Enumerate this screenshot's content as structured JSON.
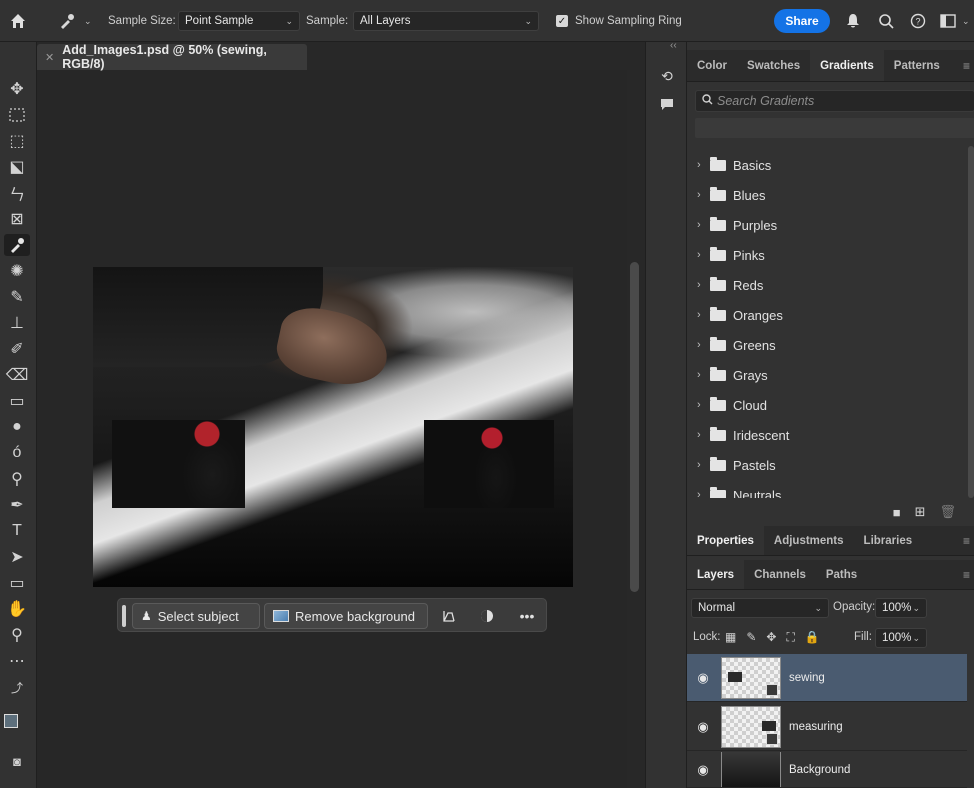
{
  "options_bar": {
    "sample_size_label": "Sample Size:",
    "sample_size_value": "Point Sample",
    "sample_label": "Sample:",
    "sample_value": "All Layers",
    "show_sampling_ring_label": "Show Sampling Ring",
    "show_sampling_ring_checked": true,
    "share_label": "Share"
  },
  "document": {
    "tab_title": "Add_Images1.psd @ 50% (sewing, RGB/8)",
    "zoom_percent": 50
  },
  "context_bar": {
    "select_subject_label": "Select subject",
    "remove_background_label": "Remove background"
  },
  "color_panel": {
    "tabs": [
      "Color",
      "Swatches",
      "Gradients",
      "Patterns"
    ],
    "active_tab": "Gradients",
    "search_placeholder": "Search Gradients",
    "folders": [
      "Basics",
      "Blues",
      "Purples",
      "Pinks",
      "Reds",
      "Oranges",
      "Greens",
      "Grays",
      "Cloud",
      "Iridescent",
      "Pastels",
      "Neutrals"
    ]
  },
  "properties_panel": {
    "tabs": [
      "Properties",
      "Adjustments",
      "Libraries"
    ],
    "active_tab": "Properties"
  },
  "layers_panel": {
    "tabs": [
      "Layers",
      "Channels",
      "Paths"
    ],
    "active_tab": "Layers",
    "blend_mode": "Normal",
    "opacity_label": "Opacity:",
    "opacity_value": "100%",
    "lock_label": "Lock:",
    "fill_label": "Fill:",
    "fill_value": "100%",
    "layers": [
      {
        "name": "sewing",
        "selected": true,
        "visible": true
      },
      {
        "name": "measuring",
        "selected": false,
        "visible": true
      },
      {
        "name": "Background",
        "selected": false,
        "visible": true
      }
    ]
  },
  "colors": {
    "accent": "#1473e6",
    "selected_layer": "#4a5b70"
  }
}
